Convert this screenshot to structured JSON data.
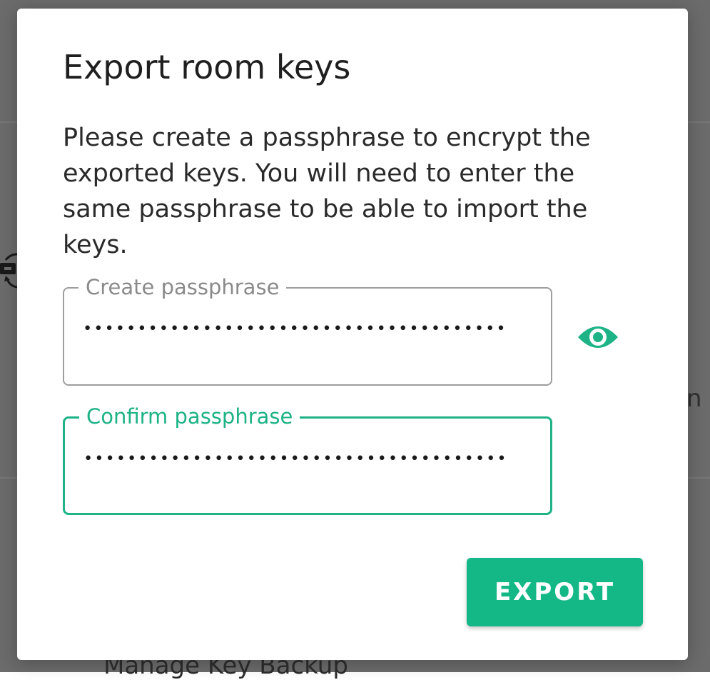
{
  "background": {
    "partial_text_right": "n",
    "bottom_item_label": "Manage Key Backup"
  },
  "dialog": {
    "title": "Export room keys",
    "message": "Please create a passphrase to encrypt the exported keys. You will need to enter the same passphrase to be able to import the keys.",
    "create_field": {
      "label": "Create passphrase",
      "value": "•••••••••••••••••••••••••••••••••••••••"
    },
    "confirm_field": {
      "label": "Confirm passphrase",
      "value": "•••••••••••••••••••••••••••••••••••••••"
    },
    "visibility_icon": "eye-icon",
    "export_label": "EXPORT"
  },
  "colors": {
    "accent": "#1db386",
    "button": "#14b887",
    "scrim": "#6b6b6b"
  }
}
